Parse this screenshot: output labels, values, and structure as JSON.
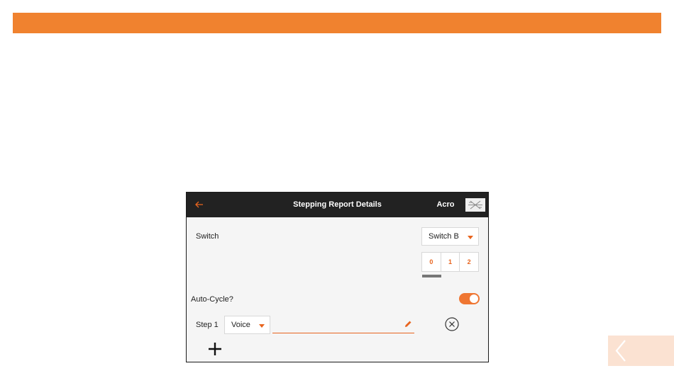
{
  "colors": {
    "accent": "#f0822f",
    "titlebar": "#222222",
    "panel": "#f5f5f5",
    "nav_button": "#fbe2d2"
  },
  "screen": {
    "back_icon": "back-arrow-icon",
    "title": "Stepping Report Details",
    "model_name": "Acro",
    "model_thumb_icon": "airplane-icon"
  },
  "switch_row": {
    "label": "Switch",
    "selected": "Switch B",
    "positions": [
      "0",
      "1",
      "2"
    ],
    "active_position": "0"
  },
  "auto_cycle": {
    "label": "Auto-Cycle?",
    "enabled": true
  },
  "steps": [
    {
      "label": "Step 1",
      "type": "Voice",
      "value": "",
      "edit_icon": "pencil-icon",
      "remove_icon": "remove-circle-icon"
    }
  ],
  "add_icon": "plus-icon",
  "page_nav": {
    "back_icon": "chevron-left-icon"
  }
}
